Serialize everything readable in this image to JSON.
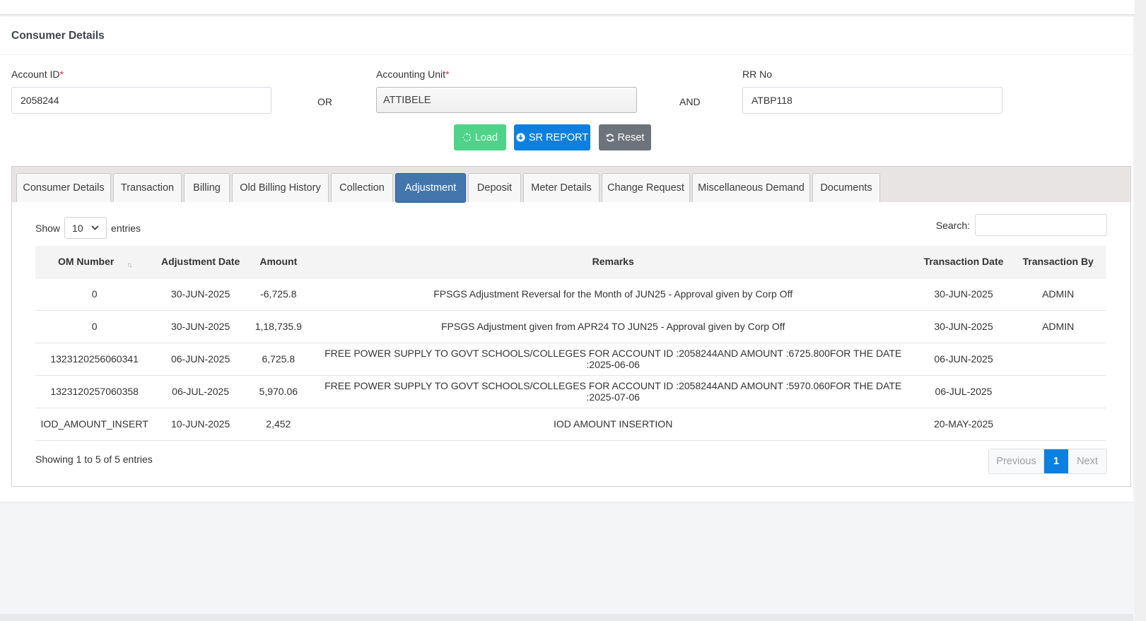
{
  "page": {
    "title": "Consumer Details"
  },
  "form": {
    "account_id_label": "Account ID",
    "account_id_value": "2058244",
    "or_label": "OR",
    "accounting_unit_label": "Accounting Unit",
    "accounting_unit_value": "ATTIBELE",
    "and_label": "AND",
    "rr_no_label": "RR No",
    "rr_no_value": "ATBP118",
    "required_mark": "*"
  },
  "buttons": {
    "load": "Load",
    "sr_report": "SR REPORT",
    "reset": "Reset"
  },
  "tabs": [
    {
      "label": "Consumer Details"
    },
    {
      "label": "Transaction"
    },
    {
      "label": "Billing"
    },
    {
      "label": "Old Billing History"
    },
    {
      "label": "Collection"
    },
    {
      "label": "Adjustment",
      "active": true
    },
    {
      "label": "Deposit"
    },
    {
      "label": "Meter Details"
    },
    {
      "label": "Change Request"
    },
    {
      "label": "Miscellaneous Demand"
    },
    {
      "label": "Documents"
    }
  ],
  "datatable": {
    "show_label": "Show",
    "page_length": "10",
    "entries_label": "entries",
    "search_label": "Search:",
    "columns": [
      "OM Number",
      "Adjustment Date",
      "Amount",
      "Remarks",
      "Transaction Date",
      "Transaction By"
    ],
    "rows": [
      [
        "0",
        "30-JUN-2025",
        "-6,725.8",
        "FPSGS Adjustment Reversal for the Month of JUN25 - Approval given by Corp Off",
        "30-JUN-2025",
        "ADMIN"
      ],
      [
        "0",
        "30-JUN-2025",
        "1,18,735.9",
        "FPSGS Adjustment given from APR24 TO JUN25 - Approval given by Corp Off",
        "30-JUN-2025",
        "ADMIN"
      ],
      [
        "1323120256060341",
        "06-JUN-2025",
        "6,725.8",
        "FREE POWER SUPPLY TO GOVT SCHOOLS/COLLEGES FOR ACCOUNT ID :2058244AND AMOUNT :6725.800FOR THE DATE :2025-06-06",
        "06-JUN-2025",
        ""
      ],
      [
        "1323120257060358",
        "06-JUL-2025",
        "5,970.06",
        "FREE POWER SUPPLY TO GOVT SCHOOLS/COLLEGES FOR ACCOUNT ID :2058244AND AMOUNT :5970.060FOR THE DATE :2025-07-06",
        "06-JUL-2025",
        ""
      ],
      [
        "IOD_AMOUNT_INSERT",
        "10-JUN-2025",
        "2,452",
        "IOD AMOUNT INSERTION",
        "20-MAY-2025",
        ""
      ]
    ],
    "info": "Showing 1 to 5 of 5 entries",
    "pagination": {
      "previous": "Previous",
      "current": "1",
      "next": "Next"
    }
  },
  "icons": {
    "load": "spinner-icon",
    "sr_report": "arrow-circle-down-icon",
    "reset": "refresh-icon",
    "sort": "sort-icon",
    "select": "chevron-down-icon"
  },
  "colors": {
    "load_button": "#4fd389",
    "sr_button": "#0c80e0",
    "reset_button": "#6c737c",
    "active_tab": "#4376ad",
    "required": "#e0333a"
  }
}
